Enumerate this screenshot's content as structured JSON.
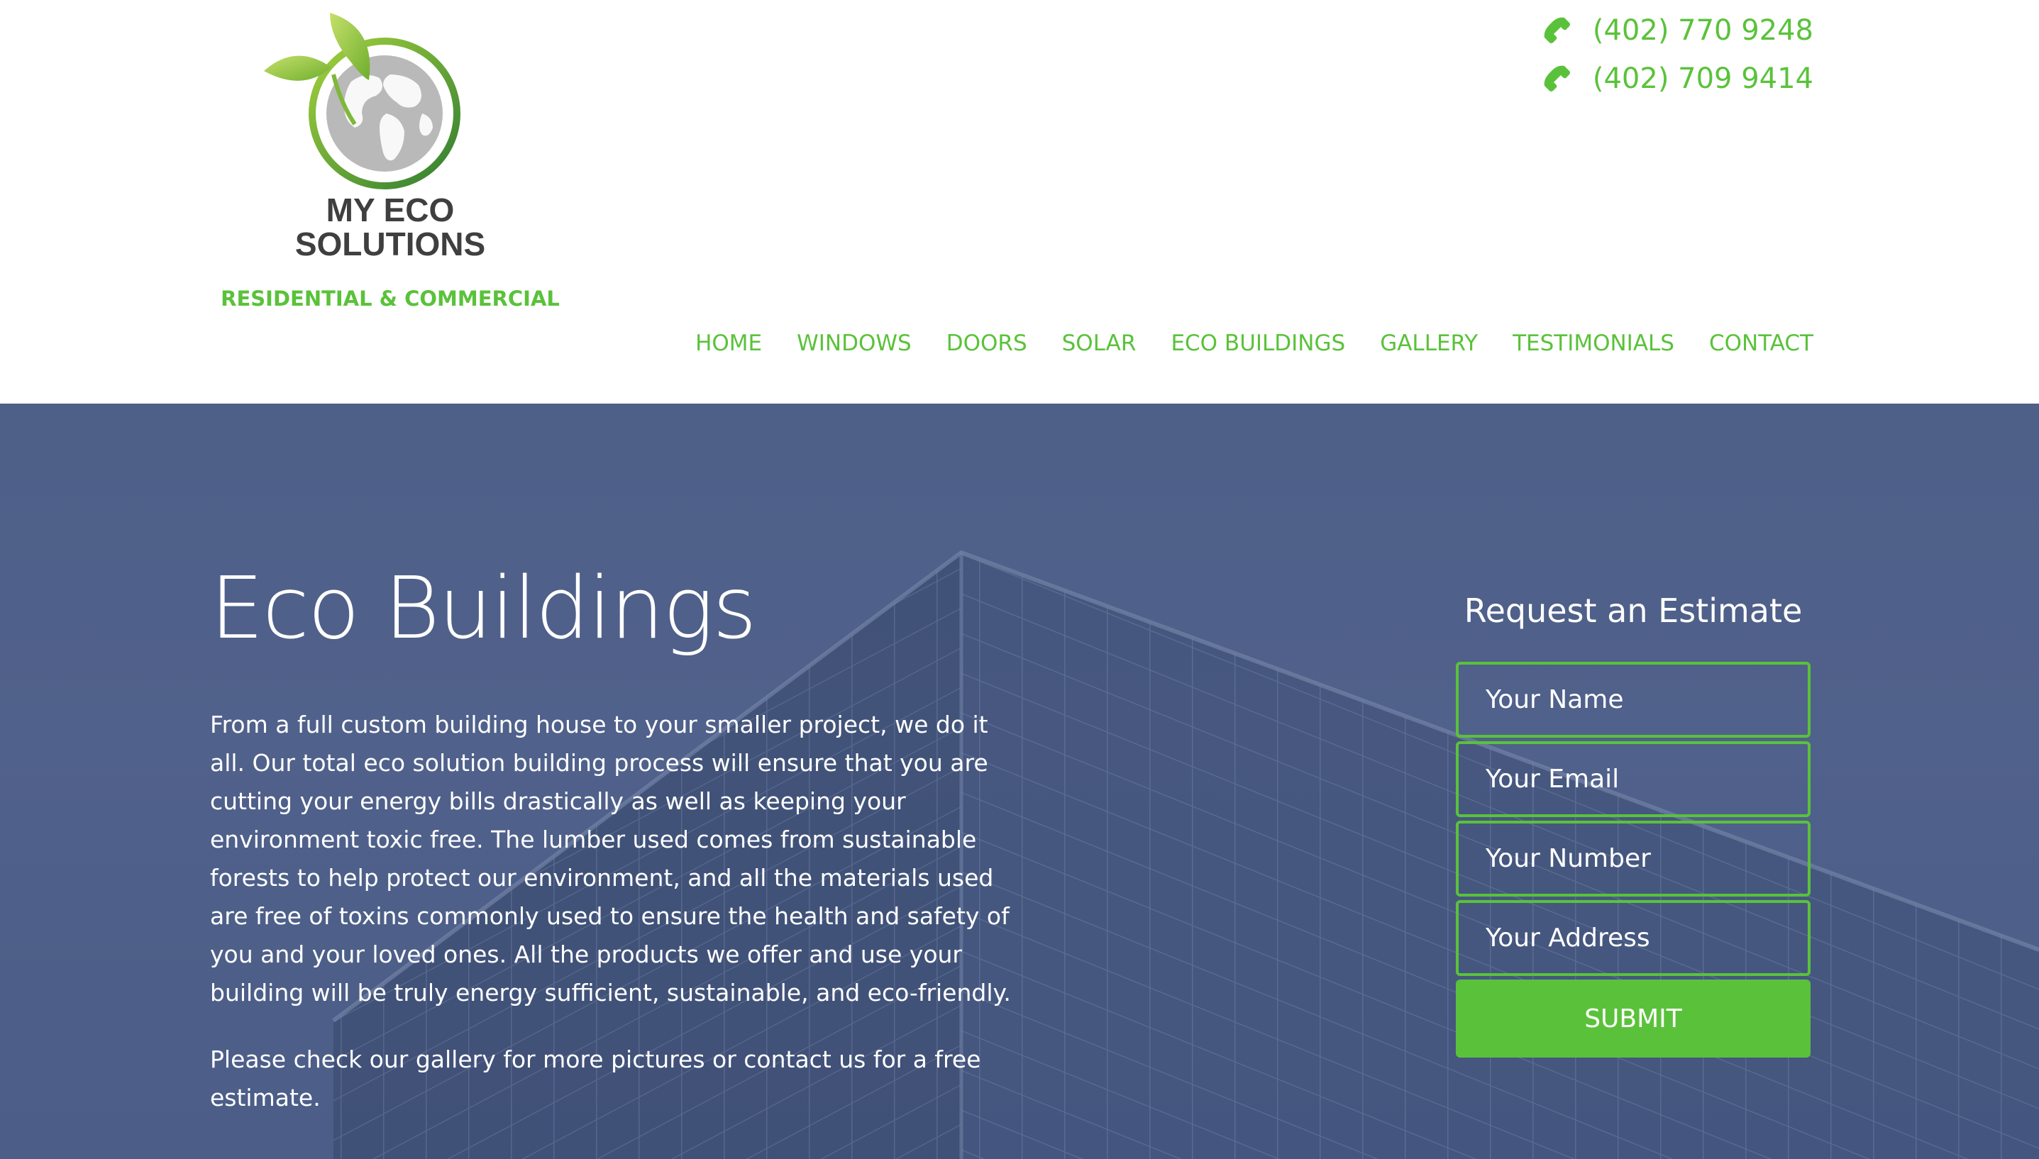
{
  "brand": {
    "name_line1": "MY ECO",
    "name_line2": "SOLUTIONS",
    "tagline": "RESIDENTIAL & COMMERCIAL",
    "accent_color": "#5ac23a",
    "logo_icon": "globe-with-leaves-icon"
  },
  "contact": {
    "phones": [
      "(402) 770 9248",
      "(402) 709 9414"
    ],
    "phone_icon": "phone-icon"
  },
  "nav": {
    "items": [
      "HOME",
      "WINDOWS",
      "DOORS",
      "SOLAR",
      "ECO BUILDINGS",
      "GALLERY",
      "TESTIMONIALS",
      "CONTACT"
    ]
  },
  "hero": {
    "title": "Eco Buildings",
    "paragraphs": [
      "From a full custom building house to your smaller project, we do it all. Our total eco solution building process will ensure that you are cutting your energy bills drastically as well as keeping your environment toxic free. The lumber used comes from sustainable forests to help protect our environment, and all the materials used are free of toxins commonly used to ensure the health and safety of you and your loved ones. All the products we offer and use your building will be truly energy sufficient, sustainable, and eco-friendly.",
      "Please check our gallery for more pictures or contact us for a free estimate."
    ],
    "background_color": "#4e6089"
  },
  "estimate_form": {
    "title": "Request an Estimate",
    "fields": {
      "name_placeholder": "Your Name",
      "email_placeholder": "Your Email",
      "number_placeholder": "Your Number",
      "address_placeholder": "Your Address"
    },
    "submit_label": "SUBMIT"
  }
}
